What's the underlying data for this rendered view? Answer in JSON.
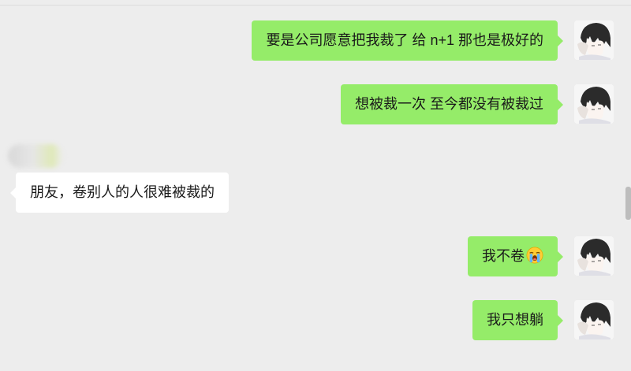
{
  "colors": {
    "background": "#ededed",
    "sent_bubble": "#95ec69",
    "received_bubble": "#ffffff",
    "text": "#1a1a1a"
  },
  "messages": [
    {
      "direction": "sent",
      "text": "要是公司愿意把我裁了 给 n+1 那也是极好的",
      "avatar": "anime-avatar-icon"
    },
    {
      "direction": "sent",
      "text": "想被裁一次 至今都没有被裁过",
      "avatar": "anime-avatar-icon"
    },
    {
      "direction": "received",
      "text": "朋友，卷别人的人很难被裁的"
    },
    {
      "direction": "sent",
      "text": "我不卷",
      "emoji": "loudly-crying-face-icon",
      "avatar": "anime-avatar-icon"
    },
    {
      "direction": "sent",
      "text": "我只想躺",
      "avatar": "anime-avatar-icon"
    }
  ]
}
